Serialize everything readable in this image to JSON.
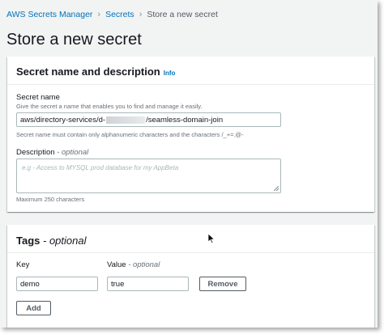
{
  "breadcrumb": {
    "root": "AWS Secrets Manager",
    "secrets": "Secrets",
    "current": "Store a new secret"
  },
  "page_title": "Store a new secret",
  "details_panel": {
    "title": "Secret name and description",
    "info": "Info",
    "name_label": "Secret name",
    "name_hint": "Give the secret a name that enables you to find and manage it easily.",
    "name_value_prefix": "aws/directory-services/d-",
    "name_value_suffix": "/seamless-domain-join",
    "name_constraint": "Secret name must contain only alphanumeric characters and the characters /_+=.@-",
    "description_label": "Description",
    "description_optional": "- optional",
    "description_placeholder": "e.g - Access to MYSQL prod database for my AppBeta",
    "description_max": "Maximum 250 characters"
  },
  "tags_panel": {
    "title": "Tags",
    "title_optional": "- optional",
    "key_label": "Key",
    "value_label": "Value",
    "value_optional": "- optional",
    "tags": [
      {
        "key": "demo",
        "value": "true"
      }
    ],
    "remove_label": "Remove",
    "add_label": "Add"
  }
}
